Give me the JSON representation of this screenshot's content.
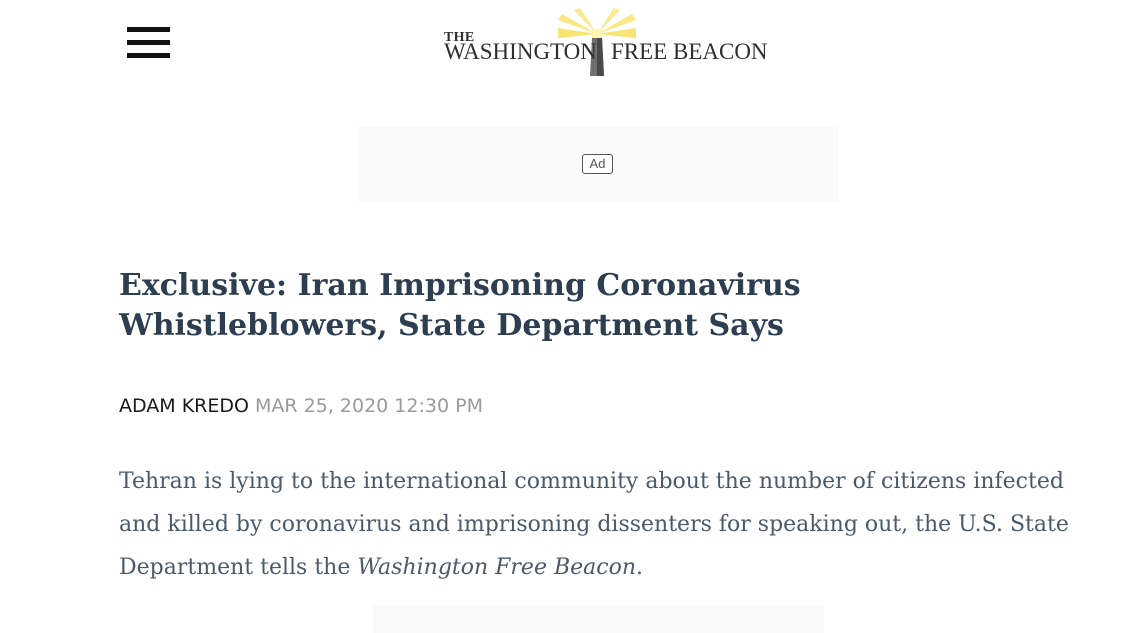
{
  "header": {
    "menu_icon": "hamburger-menu-icon",
    "logo": {
      "the": "THE",
      "left": "WASHINGTON",
      "right": "FREE BEACON",
      "icon": "lighthouse-icon",
      "beam_color": "#f7e15a"
    }
  },
  "ad": {
    "label": "Ad"
  },
  "article": {
    "headline": "Exclusive: Iran Imprisoning Coronavirus Whistleblowers, State Department Says",
    "author": "ADAM KREDO",
    "date": "MAR 25, 2020 12:30 PM",
    "lede_before": "Tehran is lying to the international community about the number of citizens infected and killed by coronavirus and imprisoning dissenters for speaking out, the U.S. State Department tells the ",
    "lede_publication": "Washington Free Beacon",
    "lede_after": "."
  },
  "colors": {
    "headline": "#2c3e50",
    "body_text": "#4a5a6a",
    "meta_date": "#9a9a9a",
    "ad_background": "#fafafa"
  }
}
